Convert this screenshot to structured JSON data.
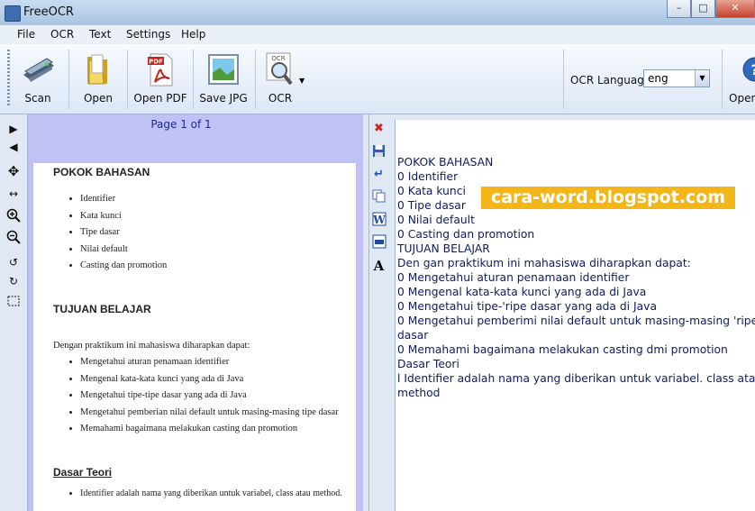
{
  "window": {
    "title": "FreeOCR",
    "min_glyph": "–",
    "max_glyph": "□",
    "close_glyph": "✕"
  },
  "menu": [
    "File",
    "OCR",
    "Text",
    "Settings",
    "Help"
  ],
  "toolbar": {
    "scan": "Scan",
    "open": "Open",
    "open_pdf": "Open PDF",
    "pdf_badge": "PDF",
    "save_jpg": "Save JPG",
    "ocr": "OCR",
    "ocr_badge": "OCR",
    "ocr_language_label": "OCR Language:",
    "ocr_language_value": "eng",
    "open_right": "Open"
  },
  "viewer": {
    "page_indicator": "Page 1 of 1",
    "document": {
      "heading1": "POKOK BAHASAN",
      "list1": [
        "Identifier",
        "Kata kunci",
        "Tipe dasar",
        "Nilai default",
        "Casting dan promotion"
      ],
      "heading2": "TUJUAN BELAJAR",
      "intro": "Dengan praktikum ini mahasiswa diharapkan dapat:",
      "list2": [
        "Mengetahui aturan penamaan identifier",
        "Mengenal kata-kata kunci yang ada di Java",
        "Mengetahui tipe-tipe dasar yang ada di Java",
        "Mengetahui pemberian nilai default untuk masing-masing tipe dasar",
        "Memahami bagaimana melakukan casting dan promotion"
      ],
      "heading3": "Dasar Teori",
      "list3": [
        "Identifier adalah nama yang diberikan untuk variabel, class atau method."
      ]
    }
  },
  "ocr_text": [
    "POKOK BAHASAN",
    "0 Identifier",
    "0 Kata kunci",
    "0 Tipe dasar",
    "0 Nilai default",
    "0 Casting dan promotion",
    "TUJUAN BELAJAR",
    "Den gan praktikum ini mahasiswa diharapkan dapat:",
    "0 Mengetahui aturan penamaan identifier",
    "0 Mengenal kata-kata kunci yang ada di Java",
    "0 Mengetahui tipe-'ripe dasar yang ada di Java",
    "0 Mengetahui pemberimi nilai default untuk masing-masing 'ripe",
    "dasar",
    "0 Memahami bagaimana melakukan casting dmi promotion",
    "Dasar Teori",
    "l Identifier adalah nama yang diberikan untuk variabel. class atau",
    "method"
  ],
  "watermark": "cara-word.blogspot.com"
}
